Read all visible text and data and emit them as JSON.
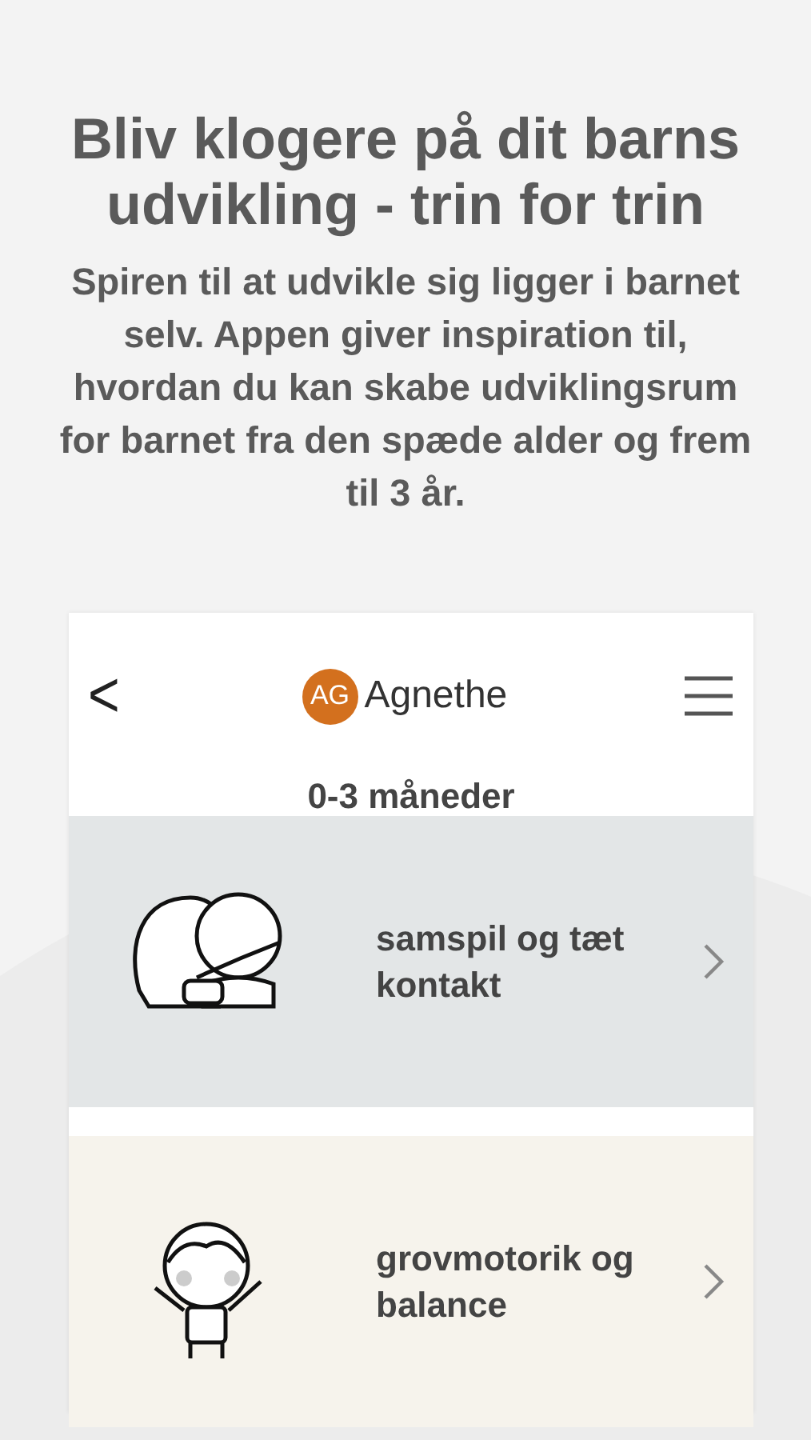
{
  "headline": "Bliv klogere på dit barns udvikling - trin for trin",
  "description": "Spiren til at udvikle sig ligger i barnet selv. Appen giver inspiration til, hvordan du kan skabe udviklingsrum for barnet fra den spæde alder og frem til 3 år.",
  "app": {
    "back_icon": "<",
    "profile": {
      "initials": "AG",
      "name": "Agnethe"
    },
    "age_group": "0-3 måneder",
    "categories": [
      {
        "kind": "hug",
        "label": "samspil og tæt kontakt",
        "color": "#e3e6e7"
      },
      {
        "kind": "jump",
        "label": "grovmotorik og balance",
        "color": "#f6f3ec"
      }
    ]
  }
}
